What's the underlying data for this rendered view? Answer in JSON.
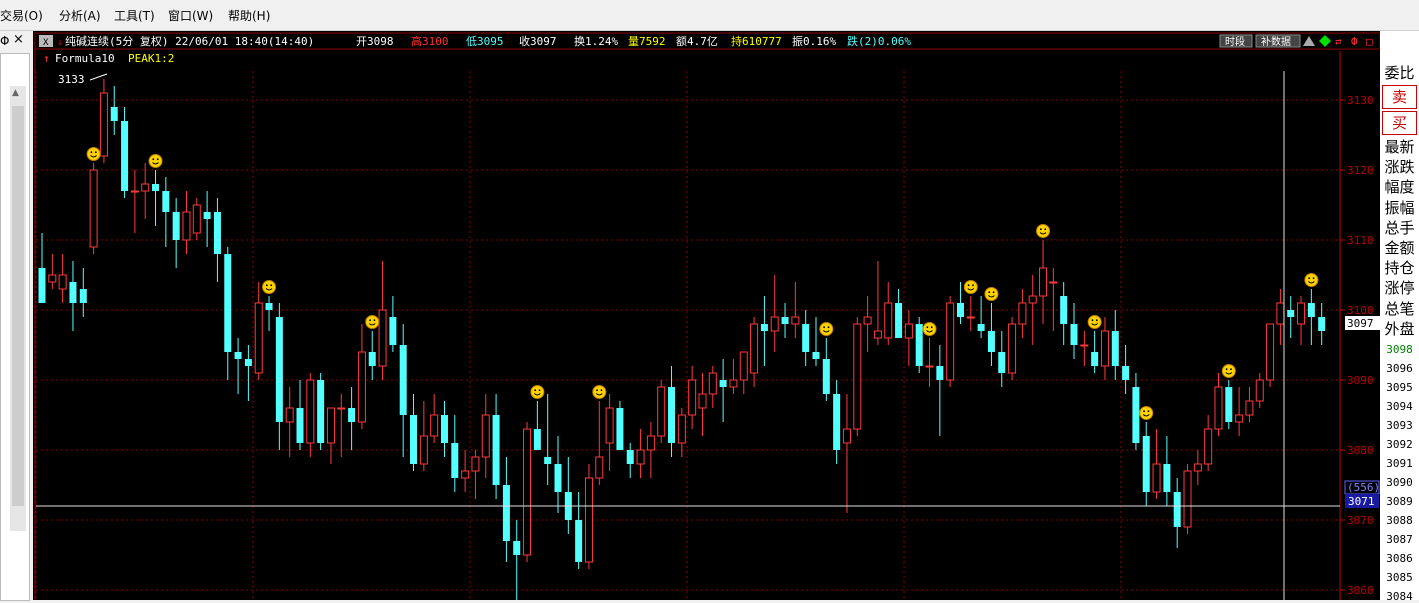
{
  "menu": [
    "交易(O)",
    "分析(A)",
    "工具(T)",
    "窗口(W)",
    "帮助(H)"
  ],
  "left_panel": {
    "title": "Φ",
    "close": "×"
  },
  "header": {
    "icon_x": "X",
    "symbol": "纯碱连续(5分 复权) 22/06/01 18:40(14:40)",
    "open": "开3098",
    "high": "高3100",
    "low": "低3095",
    "close": "收3097",
    "turnover": "换1.24%",
    "volume": "量7592",
    "amount": "额4.7亿",
    "position": "持610777",
    "amplitude": "振0.16%",
    "change": "跌(2)0.06%",
    "btn_period": "时段",
    "btn_fill": "补数据"
  },
  "indicator": {
    "name": "Formula10",
    "peak": "PEAK1:2"
  },
  "chart_data": {
    "type": "candlestick",
    "ylim": [
      3057,
      3134
    ],
    "y_ticks": [
      3060,
      3070,
      3080,
      3090,
      3100,
      3110,
      3120,
      3130
    ],
    "peak_label": "3133",
    "last_price": "3097",
    "crosshair": {
      "count": "(556)",
      "price": "3071"
    },
    "colors": {
      "up": "#ff3a3a",
      "down": "#54ffff",
      "grid": "#8b0000",
      "axis": "#c00000"
    },
    "candles": [
      [
        3106,
        3111,
        3102,
        3101
      ],
      [
        3104,
        3108,
        3103,
        3105
      ],
      [
        3103,
        3108,
        3101,
        3105
      ],
      [
        3104,
        3107,
        3097,
        3101
      ],
      [
        3103,
        3106,
        3099,
        3101
      ],
      [
        3109,
        3121,
        3108,
        3120
      ],
      [
        3122,
        3133,
        3121,
        3131
      ],
      [
        3129,
        3132,
        3125,
        3127
      ],
      [
        3127,
        3129,
        3116,
        3117
      ],
      [
        3117,
        3120,
        3111,
        3117
      ],
      [
        3117,
        3121,
        3113,
        3118
      ],
      [
        3118,
        3120,
        3112,
        3117
      ],
      [
        3117,
        3119,
        3109,
        3114
      ],
      [
        3114,
        3116,
        3106,
        3110
      ],
      [
        3110,
        3117,
        3108,
        3114
      ],
      [
        3111,
        3116,
        3110,
        3115
      ],
      [
        3114,
        3117,
        3109,
        3113
      ],
      [
        3114,
        3116,
        3104,
        3108
      ],
      [
        3108,
        3109,
        3090,
        3094
      ],
      [
        3094,
        3096,
        3088,
        3093
      ],
      [
        3093,
        3095,
        3087,
        3092
      ],
      [
        3091,
        3104,
        3090,
        3101
      ],
      [
        3101,
        3102,
        3097,
        3100
      ],
      [
        3099,
        3101,
        3080,
        3084
      ],
      [
        3084,
        3089,
        3079,
        3086
      ],
      [
        3086,
        3090,
        3080,
        3081
      ],
      [
        3081,
        3091,
        3079,
        3090
      ],
      [
        3090,
        3091,
        3080,
        3081
      ],
      [
        3081,
        3086,
        3078,
        3086
      ],
      [
        3086,
        3088,
        3079,
        3086
      ],
      [
        3086,
        3089,
        3080,
        3084
      ],
      [
        3084,
        3098,
        3083,
        3094
      ],
      [
        3094,
        3097,
        3090,
        3092
      ],
      [
        3092,
        3107,
        3090,
        3100
      ],
      [
        3099,
        3102,
        3094,
        3095
      ],
      [
        3095,
        3098,
        3079,
        3085
      ],
      [
        3085,
        3088,
        3077,
        3078
      ],
      [
        3078,
        3087,
        3077,
        3082
      ],
      [
        3082,
        3088,
        3081,
        3085
      ],
      [
        3085,
        3087,
        3079,
        3081
      ],
      [
        3081,
        3085,
        3074,
        3076
      ],
      [
        3076,
        3080,
        3074,
        3077
      ],
      [
        3077,
        3080,
        3073,
        3079
      ],
      [
        3079,
        3088,
        3076,
        3085
      ],
      [
        3085,
        3088,
        3073,
        3075
      ],
      [
        3075,
        3079,
        3064,
        3067
      ],
      [
        3067,
        3070,
        3057,
        3065
      ],
      [
        3065,
        3084,
        3064,
        3083
      ],
      [
        3083,
        3087,
        3080,
        3080
      ],
      [
        3079,
        3088,
        3075,
        3078
      ],
      [
        3078,
        3082,
        3071,
        3074
      ],
      [
        3074,
        3079,
        3068,
        3070
      ],
      [
        3070,
        3074,
        3063,
        3064
      ],
      [
        3064,
        3078,
        3063,
        3076
      ],
      [
        3076,
        3087,
        3075,
        3079
      ],
      [
        3081,
        3088,
        3077,
        3086
      ],
      [
        3086,
        3087,
        3080,
        3080
      ],
      [
        3080,
        3081,
        3076,
        3078
      ],
      [
        3078,
        3083,
        3076,
        3080
      ],
      [
        3080,
        3084,
        3076,
        3082
      ],
      [
        3082,
        3090,
        3081,
        3089
      ],
      [
        3089,
        3092,
        3079,
        3081
      ],
      [
        3081,
        3086,
        3079,
        3085
      ],
      [
        3085,
        3092,
        3083,
        3090
      ],
      [
        3086,
        3091,
        3082,
        3088
      ],
      [
        3088,
        3092,
        3086,
        3091
      ],
      [
        3090,
        3093,
        3084,
        3089
      ],
      [
        3089,
        3093,
        3088,
        3090
      ],
      [
        3090,
        3093,
        3088,
        3094
      ],
      [
        3091,
        3099,
        3089,
        3098
      ],
      [
        3098,
        3102,
        3092,
        3097
      ],
      [
        3097,
        3105,
        3094,
        3099
      ],
      [
        3099,
        3101,
        3096,
        3098
      ],
      [
        3098,
        3104,
        3096,
        3099
      ],
      [
        3098,
        3100,
        3092,
        3094
      ],
      [
        3094,
        3099,
        3092,
        3093
      ],
      [
        3093,
        3096,
        3087,
        3088
      ],
      [
        3088,
        3090,
        3078,
        3080
      ],
      [
        3081,
        3088,
        3071,
        3083
      ],
      [
        3083,
        3099,
        3082,
        3098
      ],
      [
        3098,
        3102,
        3094,
        3099
      ],
      [
        3096,
        3107,
        3095,
        3097
      ],
      [
        3096,
        3104,
        3095,
        3101
      ],
      [
        3101,
        3103,
        3096,
        3096
      ],
      [
        3096,
        3100,
        3092,
        3098
      ],
      [
        3098,
        3099,
        3091,
        3092
      ],
      [
        3092,
        3096,
        3089,
        3092
      ],
      [
        3092,
        3095,
        3082,
        3090
      ],
      [
        3090,
        3102,
        3089,
        3101
      ],
      [
        3101,
        3104,
        3098,
        3099
      ],
      [
        3099,
        3102,
        3097,
        3099
      ],
      [
        3098,
        3102,
        3096,
        3097
      ],
      [
        3097,
        3101,
        3092,
        3094
      ],
      [
        3094,
        3097,
        3089,
        3091
      ],
      [
        3091,
        3099,
        3090,
        3098
      ],
      [
        3098,
        3103,
        3096,
        3101
      ],
      [
        3101,
        3105,
        3095,
        3102
      ],
      [
        3102,
        3110,
        3098,
        3106
      ],
      [
        3104,
        3106,
        3097,
        3104
      ],
      [
        3102,
        3104,
        3095,
        3098
      ],
      [
        3098,
        3101,
        3093,
        3095
      ],
      [
        3095,
        3097,
        3092,
        3095
      ],
      [
        3094,
        3097,
        3091,
        3092
      ],
      [
        3092,
        3099,
        3090,
        3097
      ],
      [
        3097,
        3100,
        3090,
        3092
      ],
      [
        3092,
        3095,
        3088,
        3090
      ],
      [
        3089,
        3091,
        3080,
        3081
      ],
      [
        3082,
        3084,
        3072,
        3074
      ],
      [
        3074,
        3083,
        3073,
        3078
      ],
      [
        3078,
        3082,
        3072,
        3074
      ],
      [
        3074,
        3076,
        3066,
        3069
      ],
      [
        3069,
        3078,
        3068,
        3077
      ],
      [
        3077,
        3080,
        3075,
        3078
      ],
      [
        3078,
        3085,
        3077,
        3083
      ],
      [
        3083,
        3091,
        3082,
        3089
      ],
      [
        3089,
        3090,
        3083,
        3084
      ],
      [
        3084,
        3089,
        3082,
        3085
      ],
      [
        3085,
        3089,
        3084,
        3087
      ],
      [
        3087,
        3091,
        3086,
        3090
      ],
      [
        3090,
        3098,
        3089,
        3098
      ],
      [
        3098,
        3103,
        3095,
        3101
      ],
      [
        3100,
        3102,
        3096,
        3099
      ],
      [
        3098,
        3102,
        3095,
        3101
      ],
      [
        3101,
        3103,
        3095,
        3099
      ],
      [
        3099,
        3101,
        3095,
        3097
      ]
    ],
    "smiley_candles": [
      5,
      11,
      22,
      32,
      48,
      54,
      76,
      86,
      90,
      92,
      97,
      102,
      107,
      115,
      123
    ]
  },
  "sidebar": {
    "weibi": "委比",
    "sell": "卖",
    "buy": "买",
    "labels": [
      "最新",
      "涨跌",
      "幅度",
      "振幅",
      "总手",
      "金额",
      "持仓",
      "涨停",
      "总笔",
      "外盘"
    ],
    "values": [
      "3098",
      "3096",
      "3095",
      "3094",
      "3093",
      "3092",
      "3091",
      "3090",
      "3089",
      "3088",
      "3087",
      "3086",
      "3085",
      "3084"
    ]
  }
}
